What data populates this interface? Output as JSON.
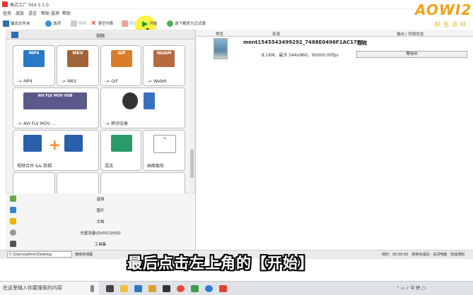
{
  "window": {
    "title": "格式工厂 X64 5.1.0",
    "menu": [
      "任务",
      "皮肤",
      "语言",
      "帮助",
      "选项",
      "帮助"
    ]
  },
  "toolbar": {
    "output_folder": "输出文件夹",
    "options": "选项",
    "remove": "移除",
    "clear_list": "清空列表",
    "stop": "停止",
    "start": "开始",
    "download_tip": "请下载官方正式版"
  },
  "left": {
    "category_video": "视频",
    "tiles": [
      {
        "badge": "MP4",
        "label": "-> MP4"
      },
      {
        "badge": "MKV",
        "label": "-> MKV"
      },
      {
        "badge": "GIF",
        "label": "-> GIF"
      },
      {
        "badge": "WebM",
        "label": "-> WebM"
      },
      {
        "badge": "AVI FLV MOV VOB",
        "label": "-> AVI FLV MOV ...."
      },
      {
        "badge": "",
        "label": "-> 移动设备"
      },
      {
        "badge": "",
        "label": "视频合并 && 剪辑"
      },
      {
        "badge": "",
        "label": "混流"
      },
      {
        "badge": "",
        "label": "画面裁剪"
      }
    ],
    "categories": [
      "音频",
      "图片",
      "文档",
      "光驱设备\\DVD\\CD\\ISO",
      "工具集"
    ]
  },
  "right": {
    "headers": [
      "预览",
      "来源",
      "输出 / 转换状态"
    ],
    "task": {
      "filename": "ment1545543499292_7488E0496F1AC17F0",
      "mode": "混流",
      "info": "8.16M，最大 544x960，90000.00fps",
      "status": "等待中"
    }
  },
  "statusbar": {
    "path": "C:\\Users\\admin\\Desktop",
    "multithread": "使用多线程",
    "elapsed": "耗时：00:00:00",
    "after": "转换完成后：关闭电脑",
    "notify": "完成通知"
  },
  "caption": "最后点击左上角的【开始】",
  "taskbar": {
    "search_placeholder": "在这里输入你要搜索的内容"
  },
  "logo": {
    "main": "AOWI2",
    "sub": "好生活好"
  },
  "colors": {
    "accent": "#f2a31b",
    "highlight": "#fff000"
  }
}
